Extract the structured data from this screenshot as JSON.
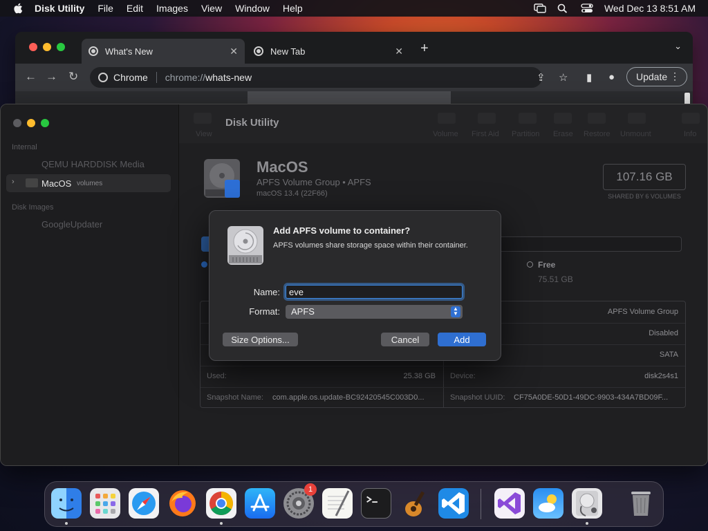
{
  "menubar": {
    "app_name": "Disk Utility",
    "items": [
      "File",
      "Edit",
      "Images",
      "View",
      "Window",
      "Help"
    ],
    "datetime": "Wed Dec 13  8:51 AM"
  },
  "chrome": {
    "tabs": [
      {
        "title": "What's New"
      },
      {
        "title": "New Tab"
      }
    ],
    "omnibox": {
      "site_label": "Chrome",
      "scheme": "chrome://",
      "path": "whats-new"
    },
    "update_label": "Update"
  },
  "disk_utility": {
    "window_title": "Disk Utility",
    "sidebar": {
      "section_internal": "Internal",
      "item_disk": "QEMU HARDDISK Media",
      "item_selected": "MacOS",
      "item_selected_sub": "volumes",
      "section_images": "Disk Images",
      "item_image": "GoogleUpdater"
    },
    "toolbar": [
      "View",
      "Volume",
      "First Aid",
      "Partition",
      "Erase",
      "Restore",
      "Unmount",
      "Info"
    ],
    "volume": {
      "name": "MacOS",
      "subtitle": "APFS Volume Group • APFS",
      "os": "macOS 13.4 (22F66)",
      "capacity": "107.16 GB",
      "capacity_note": "SHARED BY 6 VOLUMES",
      "free_label": "Free",
      "free_value": "75.51 GB",
      "used_fraction": 0.237
    },
    "info": {
      "right_rows": [
        "APFS Volume Group",
        "Disabled",
        "SATA"
      ],
      "used_key": "Used:",
      "used_val": "25.38 GB",
      "device_key": "Device:",
      "device_val": "disk2s4s1",
      "snapshot_name_key": "Snapshot Name:",
      "snapshot_name_val": "com.apple.os.update-BC92420545C003D0...",
      "snapshot_uuid_key": "Snapshot UUID:",
      "snapshot_uuid_val": "CF75A0DE-50D1-49DC-9903-434A7BD09F..."
    }
  },
  "dialog": {
    "title": "Add APFS volume to container?",
    "message": "APFS volumes share storage space within their container.",
    "name_label": "Name:",
    "name_value": "eve",
    "format_label": "Format:",
    "format_value": "APFS",
    "size_options": "Size Options...",
    "cancel": "Cancel",
    "add": "Add"
  },
  "dock": {
    "apps": [
      "finder-icon",
      "launchpad-icon",
      "safari-icon",
      "firefox-icon",
      "chrome-icon",
      "app-store-icon",
      "system-settings-icon",
      "textedit-icon",
      "terminal-icon",
      "garageband-icon",
      "vscode-icon",
      "visual-studio-icon",
      "weather-icon",
      "disk-utility-icon",
      "trash-icon"
    ],
    "settings_badge": "1"
  }
}
